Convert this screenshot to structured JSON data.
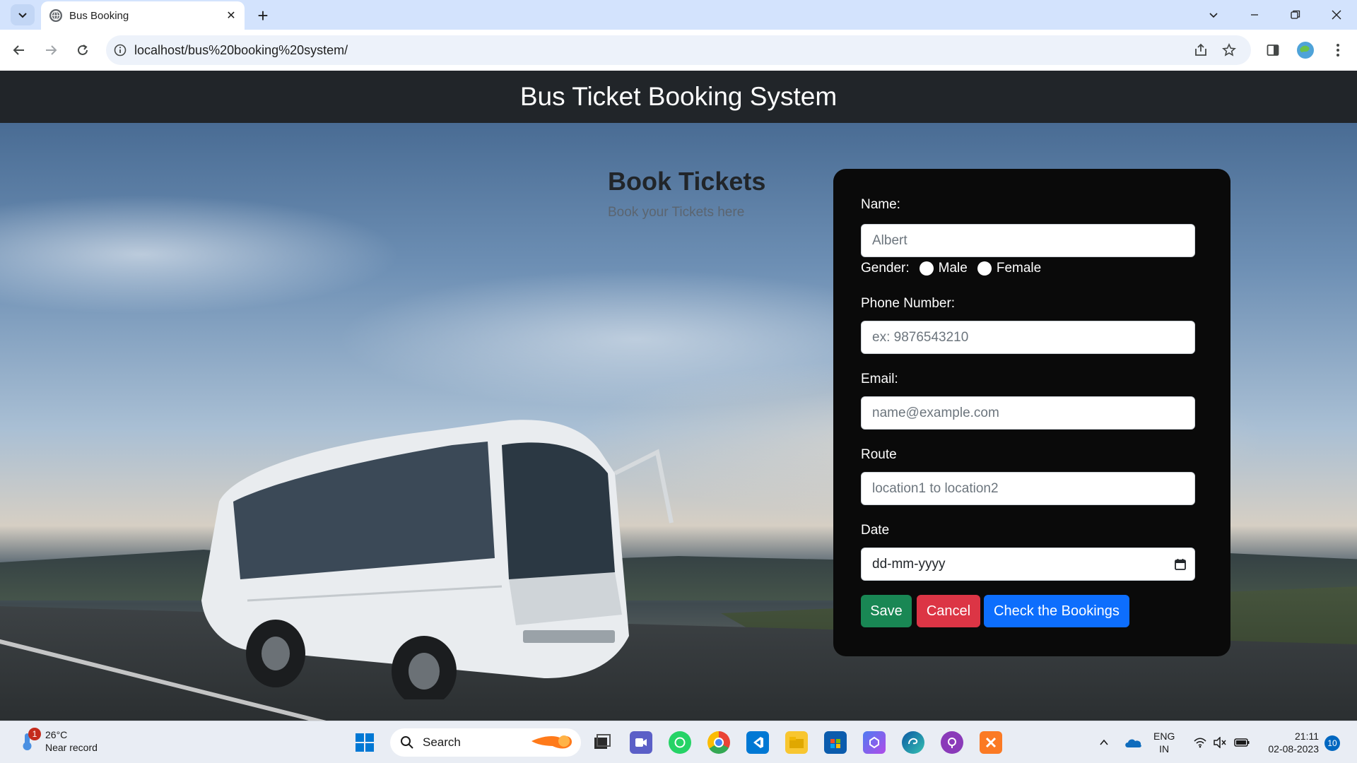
{
  "browser": {
    "tab_title": "Bus Booking",
    "url": "localhost/bus%20booking%20system/"
  },
  "navbar": {
    "title": "Bus Ticket Booking System"
  },
  "hero": {
    "title": "Book Tickets",
    "subtitle": "Book your Tickets here"
  },
  "form": {
    "name_label": "Name:",
    "name_placeholder": "Albert",
    "gender_label": "Gender:",
    "gender_options": [
      "Male",
      "Female"
    ],
    "phone_label": "Phone Number:",
    "phone_placeholder": "ex: 9876543210",
    "email_label": "Email:",
    "email_placeholder": "name@example.com",
    "route_label": "Route",
    "route_placeholder": "location1 to location2",
    "date_label": "Date",
    "date_value": "dd-mm-yyyy",
    "save_label": "Save",
    "cancel_label": "Cancel",
    "check_label": "Check the Bookings"
  },
  "colors": {
    "navbar": "#212529",
    "card": "#0a0a0a",
    "save": "#198754",
    "cancel": "#dc3545",
    "check": "#0d6efd"
  },
  "taskbar": {
    "weather_temp": "26°C",
    "weather_desc": "Near record",
    "weather_badge": "1",
    "search_label": "Search",
    "lang_top": "ENG",
    "lang_bottom": "IN",
    "time": "21:11",
    "date": "02-08-2023",
    "notifications": "10",
    "pinned_icons": [
      "windows-start-icon",
      "task-view-icon",
      "teams-icon",
      "whatsapp-icon",
      "chrome-icon",
      "vscode-icon",
      "file-explorer-icon",
      "microsoft-store-icon",
      "copilot-icon",
      "edge-icon",
      "github-icon",
      "xampp-icon"
    ]
  }
}
